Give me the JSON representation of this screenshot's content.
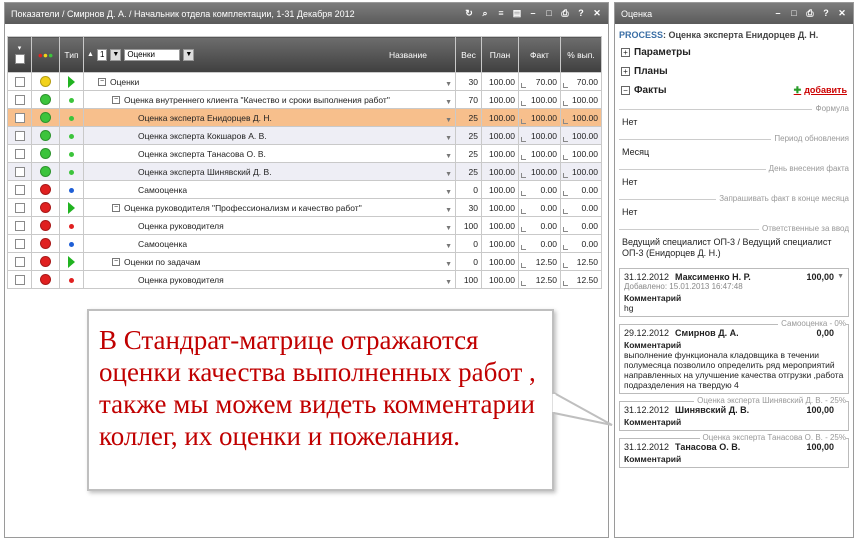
{
  "left": {
    "title": "Показатели / Смирнов Д. А. / Начальник отдела комплектации, 1-31 Декабря 2012",
    "tools": [
      "refresh-icon",
      "search-icon",
      "list-icon",
      "save-icon",
      "minimize-icon",
      "window-icon",
      "print-icon",
      "help-icon",
      "close-icon"
    ],
    "headers": {
      "type": "Тип",
      "level": "1",
      "level_select": "Оценки",
      "name": "Название",
      "weight": "Вес",
      "plan": "План",
      "fact": "Факт",
      "pct": "% вып."
    },
    "rows": [
      {
        "status": "yellow",
        "type": "tri",
        "indent": 0,
        "expander": "minus",
        "name": "Оценки",
        "weight": "30",
        "plan": "100.00",
        "fact": "70.00",
        "pct": "70.00"
      },
      {
        "status": "green",
        "type": "dot-green",
        "indent": 1,
        "expander": "minus",
        "name": "Оценка внутреннего клиента \"Качество и сроки выполнения работ\"",
        "weight": "70",
        "plan": "100.00",
        "fact": "100.00",
        "pct": "100.00"
      },
      {
        "status": "green",
        "type": "dot-green",
        "indent": 2,
        "expander": "",
        "name": "Оценка эксперта Енидорцев Д. Н.",
        "weight": "25",
        "plan": "100.00",
        "fact": "100.00",
        "pct": "100.00"
      },
      {
        "status": "green",
        "type": "dot-green",
        "indent": 2,
        "expander": "",
        "name": "Оценка эксперта Кокшаров А. В.",
        "weight": "25",
        "plan": "100.00",
        "fact": "100.00",
        "pct": "100.00"
      },
      {
        "status": "green",
        "type": "dot-green",
        "indent": 2,
        "expander": "",
        "name": "Оценка эксперта Танасова О. В.",
        "weight": "25",
        "plan": "100.00",
        "fact": "100.00",
        "pct": "100.00"
      },
      {
        "status": "green",
        "type": "dot-green",
        "indent": 2,
        "expander": "",
        "name": "Оценка эксперта Шинявский Д. В.",
        "weight": "25",
        "plan": "100.00",
        "fact": "100.00",
        "pct": "100.00"
      },
      {
        "status": "red",
        "type": "dot-blue",
        "indent": 2,
        "expander": "",
        "name": "Самооценка",
        "weight": "0",
        "plan": "100.00",
        "fact": "0.00",
        "pct": "0.00"
      },
      {
        "status": "red",
        "type": "tri",
        "indent": 1,
        "expander": "minus",
        "name": "Оценка руководителя \"Профессионализм и качество работ\"",
        "weight": "30",
        "plan": "100.00",
        "fact": "0.00",
        "pct": "0.00"
      },
      {
        "status": "red",
        "type": "dot-red",
        "indent": 2,
        "expander": "",
        "name": "Оценка руководителя",
        "weight": "100",
        "plan": "100.00",
        "fact": "0.00",
        "pct": "0.00"
      },
      {
        "status": "red",
        "type": "dot-blue",
        "indent": 2,
        "expander": "",
        "name": "Самооценка",
        "weight": "0",
        "plan": "100.00",
        "fact": "0.00",
        "pct": "0.00"
      },
      {
        "status": "red",
        "type": "tri",
        "indent": 1,
        "expander": "minus",
        "name": "Оценки по задачам",
        "weight": "0",
        "plan": "100.00",
        "fact": "12.50",
        "pct": "12.50"
      },
      {
        "status": "red",
        "type": "dot-red",
        "indent": 2,
        "expander": "",
        "name": "Оценка руководителя",
        "weight": "100",
        "plan": "100.00",
        "fact": "12.50",
        "pct": "12.50"
      }
    ]
  },
  "right": {
    "title": "Оценка",
    "process_prefix": "PROCESS",
    "process_rest": ": Оценка эксперта Енидорцев Д. Н.",
    "sections": {
      "params": "Параметры",
      "plans": "Планы",
      "facts": "Факты",
      "add": "добавить"
    },
    "fields": [
      {
        "label": "Формула",
        "value": "Нет"
      },
      {
        "label": "Период обновления",
        "value": "Месяц"
      },
      {
        "label": "День внесения факта",
        "value": "Нет"
      },
      {
        "label": "Запрашивать факт в конце месяца",
        "value": "Нет"
      },
      {
        "label": "Ответственные за ввод",
        "value": "Ведущий специалист ОП-3 / Ведущий специалист ОП-3 (Енидорцев Д. Н.)"
      }
    ],
    "cards": [
      {
        "label": "",
        "date": "31.12.2012",
        "who": "Максименко Н. Р.",
        "score": "100,00",
        "added": "Добавлено: 15.01.2013 16:47:48",
        "comment_label": "Комментарий",
        "comment": "hg"
      },
      {
        "label": "Самооценка - 0%",
        "date": "29.12.2012",
        "who": "Смирнов Д. А.",
        "score": "0,00",
        "added": "",
        "comment_label": "Комментарий",
        "comment": "выполнение функционала кладовщика в течении полумесяца позволило определить ряд мероприятий направленных на улучшение качества отгрузки ,работа подразделения на твердую 4"
      },
      {
        "label": "Оценка эксперта Шинявский Д. В. - 25%",
        "date": "31.12.2012",
        "who": "Шинявский Д. В.",
        "score": "100,00",
        "added": "",
        "comment_label": "Комментарий",
        "comment": ""
      },
      {
        "label": "Оценка эксперта Танасова О. В. - 25%",
        "date": "31.12.2012",
        "who": "Танасова О. В.",
        "score": "100,00",
        "added": "",
        "comment_label": "Комментарий",
        "comment": ""
      }
    ]
  },
  "callout": {
    "text": "В Стандрат-матрице отражаются оценки качества выполненных работ , также мы можем видеть комментарии коллег, их оценки и пожелания."
  },
  "colors": {
    "yellow": "#f2d21a",
    "green": "#3cc43c",
    "red": "#e02020",
    "blue": "#1f5fd6",
    "selected_row": "#f7bf8c",
    "alt_row": "#eeeef5",
    "callout_text": "#c00000"
  }
}
